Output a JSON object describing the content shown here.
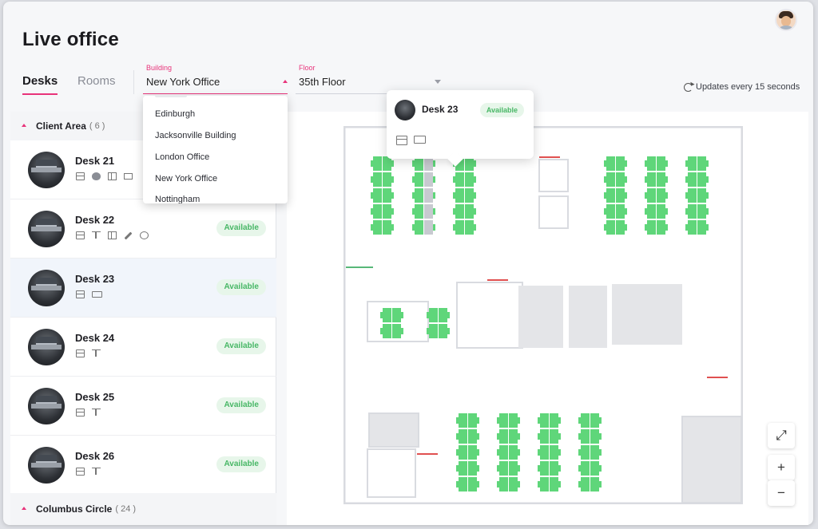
{
  "app": {
    "title": "Live office",
    "user_avatar": "user-avatar"
  },
  "tabs": [
    {
      "label": "Desks",
      "active": true
    },
    {
      "label": "Rooms",
      "active": false
    }
  ],
  "building_select": {
    "label": "Building",
    "value": "New York Office"
  },
  "floor_select": {
    "label": "Floor",
    "value": "35th Floor"
  },
  "updates_text": "Updates every 15 seconds",
  "building_options": [
    "Edinburgh",
    "Jacksonville Building",
    "London Office",
    "New York Office",
    "Nottingham"
  ],
  "groups": [
    {
      "name": "Client Area",
      "count": "( 6 )"
    },
    {
      "name": "Columbus Circle",
      "count": "( 24 )"
    }
  ],
  "desks": [
    {
      "name": "Desk 21",
      "status": "",
      "amenities": [
        "drawer-icon",
        "alien-icon",
        "window-icon",
        "monitor-icon"
      ]
    },
    {
      "name": "Desk 22",
      "status": "Available",
      "amenities": [
        "drawer-icon",
        "standing-desk-icon",
        "window-icon",
        "pen-icon",
        "gauge-icon"
      ]
    },
    {
      "name": "Desk 23",
      "status": "Available",
      "amenities": [
        "drawer-icon",
        "keyboard-icon"
      ],
      "selected": true
    },
    {
      "name": "Desk 24",
      "status": "Available",
      "amenities": [
        "drawer-icon",
        "standing-desk-icon"
      ]
    },
    {
      "name": "Desk 25",
      "status": "Available",
      "amenities": [
        "drawer-icon",
        "standing-desk-icon"
      ]
    },
    {
      "name": "Desk 26",
      "status": "Available",
      "amenities": [
        "drawer-icon",
        "standing-desk-icon"
      ]
    }
  ],
  "popover": {
    "name": "Desk 23",
    "status": "Available",
    "amenities": [
      "drawer-icon",
      "keyboard-icon"
    ]
  },
  "map_controls": {
    "zoom_in": "+",
    "zoom_out": "−",
    "fit": "⤢"
  },
  "colors": {
    "accent": "#e8337a",
    "available": "#48b766",
    "desk_fill": "#5fd67a",
    "desk_occupied": "#c7cad0"
  }
}
